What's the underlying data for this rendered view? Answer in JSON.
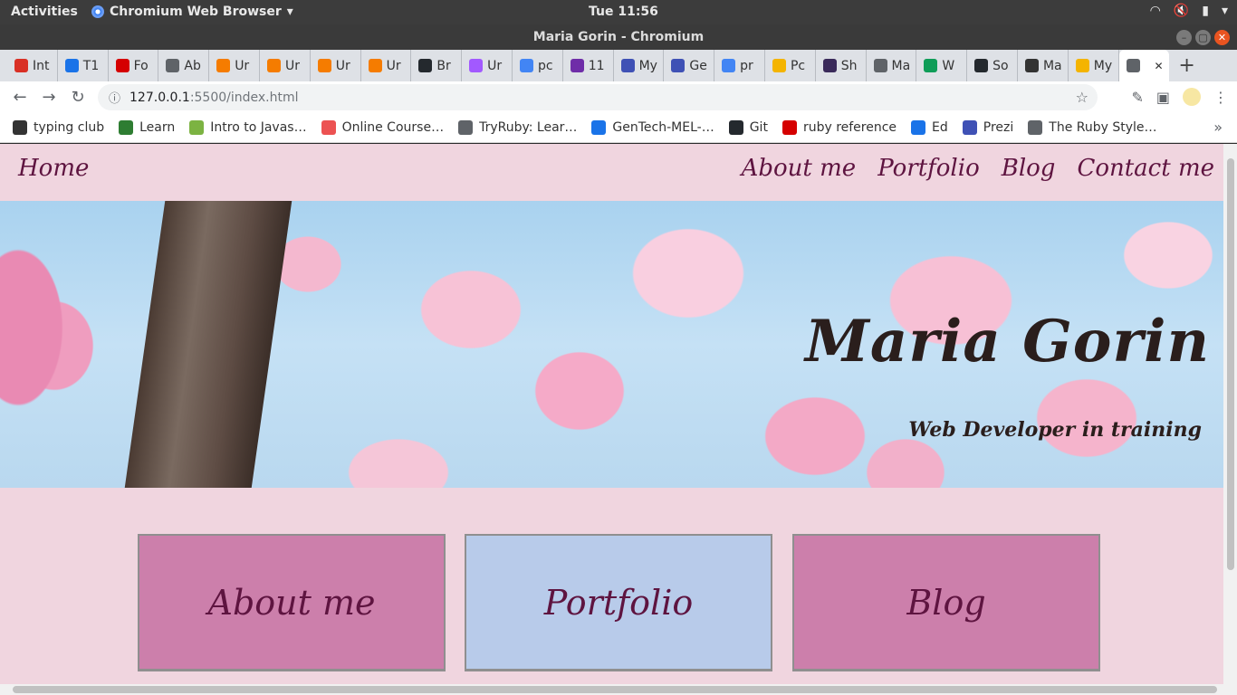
{
  "desktop": {
    "activities": "Activities",
    "app_name": "Chromium Web Browser",
    "clock": "Tue 11:56"
  },
  "window": {
    "title": "Maria Gorin - Chromium"
  },
  "tabs": [
    {
      "label": "Int",
      "favicon": "gmail-icon",
      "color": "#d93025"
    },
    {
      "label": "T1",
      "favicon": "app-academy-icon",
      "color": "#1a73e8"
    },
    {
      "label": "Fo",
      "favicon": "flag-icon",
      "color": "#d50000"
    },
    {
      "label": "Ab",
      "favicon": "globe-icon",
      "color": "#5f6368"
    },
    {
      "label": "Ur",
      "favicon": "udacity-icon",
      "color": "#f57c00"
    },
    {
      "label": "Ur",
      "favicon": "udacity-icon",
      "color": "#f57c00"
    },
    {
      "label": "Ur",
      "favicon": "udacity-icon",
      "color": "#f57c00"
    },
    {
      "label": "Ur",
      "favicon": "udacity-icon",
      "color": "#f57c00"
    },
    {
      "label": "Br",
      "favicon": "github-icon",
      "color": "#24292e"
    },
    {
      "label": "Ur",
      "favicon": "figma-icon",
      "color": "#a259ff"
    },
    {
      "label": "pc",
      "favicon": "google-icon",
      "color": "#4285f4"
    },
    {
      "label": "11",
      "favicon": "twitch-icon",
      "color": "#6f2da8"
    },
    {
      "label": "My",
      "favicon": "prezi-icon",
      "color": "#3f51b5"
    },
    {
      "label": "Ge",
      "favicon": "prezi-icon",
      "color": "#3f51b5"
    },
    {
      "label": "pr",
      "favicon": "google-icon",
      "color": "#4285f4"
    },
    {
      "label": "Pc",
      "favicon": "slides-icon",
      "color": "#f4b400"
    },
    {
      "label": "Sh",
      "favicon": "shield-icon",
      "color": "#3a2a5a"
    },
    {
      "label": "Ma",
      "favicon": "globe-icon",
      "color": "#5f6368"
    },
    {
      "label": "W",
      "favicon": "chart-icon",
      "color": "#0f9d58"
    },
    {
      "label": "So",
      "favicon": "github-icon",
      "color": "#24292e"
    },
    {
      "label": "Ma",
      "favicon": "markdown-icon",
      "color": "#333333"
    },
    {
      "label": "My",
      "favicon": "slides-icon",
      "color": "#f4b400"
    },
    {
      "label": "",
      "favicon": "globe-icon",
      "color": "#5f6368"
    }
  ],
  "toolbar": {
    "url_host": "127.0.0.1",
    "url_rest": ":5500/index.html"
  },
  "bookmarks": [
    {
      "label": "typing club",
      "icon": "typing-club-icon",
      "color": "#333333"
    },
    {
      "label": "Learn",
      "icon": "learn-icon",
      "color": "#2e7d32"
    },
    {
      "label": "Intro to Javas…",
      "icon": "hexagon-icon",
      "color": "#7cb342"
    },
    {
      "label": "Online Course…",
      "icon": "udemy-icon",
      "color": "#ec5252"
    },
    {
      "label": "TryRuby: Lear…",
      "icon": "globe-icon",
      "color": "#5f6368"
    },
    {
      "label": "GenTech-MEL-…",
      "icon": "app-academy-icon",
      "color": "#1a73e8"
    },
    {
      "label": "Git",
      "icon": "github-icon",
      "color": "#24292e"
    },
    {
      "label": "ruby reference",
      "icon": "ruby-icon",
      "color": "#d50000"
    },
    {
      "label": "Ed",
      "icon": "app-academy-icon",
      "color": "#1a73e8"
    },
    {
      "label": "Prezi",
      "icon": "prezi-icon",
      "color": "#3f51b5"
    },
    {
      "label": "The Ruby Style…",
      "icon": "globe-icon",
      "color": "#5f6368"
    }
  ],
  "site": {
    "nav": {
      "home": "Home",
      "links": [
        "About me",
        "Portfolio",
        "Blog",
        "Contact me"
      ]
    },
    "hero": {
      "title": "Maria Gorin",
      "subtitle": "Web Developer in training"
    },
    "cards": [
      "About me",
      "Portfolio",
      "Blog"
    ]
  }
}
